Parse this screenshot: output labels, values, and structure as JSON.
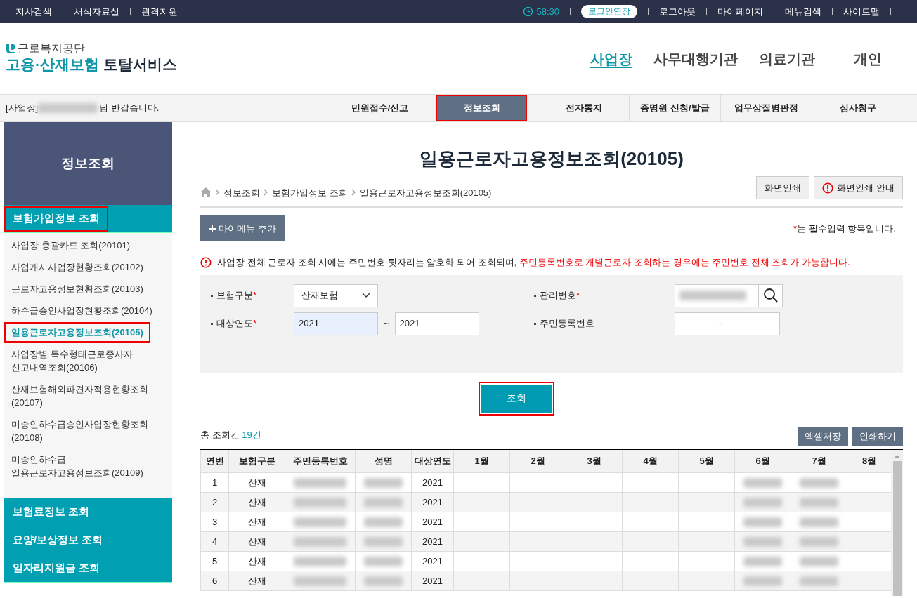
{
  "top_bar": {
    "left_links": [
      "지사검색",
      "서식자료실",
      "원격지원"
    ],
    "timer": "58:30",
    "extend_button": "로그인연장",
    "right_links": [
      "로그아웃",
      "마이페이지",
      "메뉴검색",
      "사이트맵"
    ]
  },
  "logo": {
    "org": "근로복지공단",
    "service_highlight": "고용·산재보험",
    "service": "토탈서비스"
  },
  "main_nav": [
    {
      "label": "사업장",
      "selected": true
    },
    {
      "label": "사무대행기관",
      "selected": false
    },
    {
      "label": "의료기관",
      "selected": false
    },
    {
      "label": "개인",
      "selected": false
    }
  ],
  "welcome": {
    "prefix": "[사업장]",
    "name_blurred": true,
    "suffix": "님 반갑습니다."
  },
  "tabs": [
    {
      "label": "민원접수/신고",
      "selected": false,
      "highlighted": false
    },
    {
      "label": "정보조회",
      "selected": true,
      "highlighted": true
    },
    {
      "label": "전자통지",
      "selected": false,
      "highlighted": false
    },
    {
      "label": "증명원 신청/발급",
      "selected": false,
      "highlighted": false
    },
    {
      "label": "업무상질병판정",
      "selected": false,
      "highlighted": false
    },
    {
      "label": "심사청구",
      "selected": false,
      "highlighted": false
    }
  ],
  "sidebar": {
    "title": "정보조회",
    "sections": [
      {
        "label": "보험가입정보 조회",
        "highlighted": true,
        "items": [
          {
            "label": "사업장 총괄카드 조회(20101)",
            "selected": false,
            "highlighted": false
          },
          {
            "label": "사업개시사업장현황조회(20102)",
            "selected": false,
            "highlighted": false
          },
          {
            "label": "근로자고용정보현황조회(20103)",
            "selected": false,
            "highlighted": false
          },
          {
            "label": "하수급승인사업장현황조회(20104)",
            "selected": false,
            "highlighted": false
          },
          {
            "label": "일용근로자고용정보조회(20105)",
            "selected": true,
            "highlighted": true
          },
          {
            "label": "사업장별 특수형태근로종사자\n신고내역조회(20106)",
            "selected": false,
            "highlighted": false
          },
          {
            "label": "산재보험해외파견자적용현황조회\n(20107)",
            "selected": false,
            "highlighted": false
          },
          {
            "label": "미승인하수급승인사업장현황조회\n(20108)",
            "selected": false,
            "highlighted": false
          },
          {
            "label": "미승인하수급\n일용근로자고용정보조회(20109)",
            "selected": false,
            "highlighted": false
          }
        ]
      },
      {
        "label": "보험료정보 조회",
        "highlighted": false
      },
      {
        "label": "요양/보상정보 조회",
        "highlighted": false
      },
      {
        "label": "일자리지원금 조회",
        "highlighted": false
      }
    ]
  },
  "page_title": "일용근로자고용정보조회(20105)",
  "breadcrumb": [
    "정보조회",
    "보험가입정보 조회",
    "일용근로자고용정보조회(20105)"
  ],
  "print_buttons": [
    {
      "label": "화면인쇄",
      "kind": "plain"
    },
    {
      "label": "화면인쇄 안내",
      "kind": "info"
    }
  ],
  "mymenu_button": "마이메뉴 추가",
  "required_legend": {
    "mark": "*",
    "text": "는 필수입력 항목입니다."
  },
  "notice": {
    "text": "사업장 전체 근로자 조회 시에는 주민번호 뒷자리는 암호화 되어 조회되며, ",
    "emphasis": "주민등록번호로 개별근로자 조회하는 경우에는 주민번호 전체 조회가 가능합니다."
  },
  "form": {
    "fields": [
      {
        "label": "보험구분",
        "required": true,
        "kind": "select",
        "value": "산재보험"
      },
      {
        "label": "관리번호",
        "required": true,
        "kind": "search",
        "value_blurred": true
      },
      {
        "label": "대상연도",
        "required": true,
        "kind": "range",
        "value": "2021",
        "separator": "~",
        "value_to": "2021"
      },
      {
        "label": "주민등록번호",
        "required": false,
        "kind": "rrn",
        "separator": "-"
      }
    ]
  },
  "query_button": {
    "label": "조회",
    "highlighted": true
  },
  "result": {
    "count_label": "총 조회건",
    "count": "19건",
    "buttons": [
      "엑셀저장",
      "인쇄하기"
    ]
  },
  "table": {
    "columns": [
      "연번",
      "보험구분",
      "주민등록번호",
      "성명",
      "대상연도",
      "1월",
      "2월",
      "3월",
      "4월",
      "5월",
      "6월",
      "7월",
      "8월"
    ],
    "rows": [
      {
        "cells": [
          {
            "text": "1"
          },
          {
            "text": "산재"
          },
          {
            "blurred": true
          },
          {
            "blurred": true
          },
          {
            "text": "2021"
          },
          {
            "blurred": false
          },
          {
            "blurred": false
          },
          {
            "blurred": false
          },
          {
            "blurred": false
          },
          {
            "blurred": false
          },
          {
            "blurred": true
          },
          {
            "blurred": true
          },
          {
            "blurred": false
          }
        ]
      },
      {
        "cells": [
          {
            "text": "2"
          },
          {
            "text": "산재"
          },
          {
            "blurred": true
          },
          {
            "blurred": true
          },
          {
            "text": "2021"
          },
          {
            "blurred": false
          },
          {
            "blurred": false
          },
          {
            "blurred": false
          },
          {
            "blurred": false
          },
          {
            "blurred": false
          },
          {
            "blurred": true
          },
          {
            "blurred": true
          },
          {
            "blurred": false
          }
        ]
      },
      {
        "cells": [
          {
            "text": "3"
          },
          {
            "text": "산재"
          },
          {
            "blurred": true
          },
          {
            "blurred": true
          },
          {
            "text": "2021"
          },
          {
            "blurred": false
          },
          {
            "blurred": false
          },
          {
            "blurred": false
          },
          {
            "blurred": false
          },
          {
            "blurred": false
          },
          {
            "blurred": true
          },
          {
            "blurred": true
          },
          {
            "blurred": false
          }
        ]
      },
      {
        "cells": [
          {
            "text": "4"
          },
          {
            "text": "산재"
          },
          {
            "blurred": true
          },
          {
            "blurred": true
          },
          {
            "text": "2021"
          },
          {
            "blurred": false
          },
          {
            "blurred": false
          },
          {
            "blurred": false
          },
          {
            "blurred": false
          },
          {
            "blurred": false
          },
          {
            "blurred": true
          },
          {
            "blurred": true
          },
          {
            "blurred": false
          }
        ]
      },
      {
        "cells": [
          {
            "text": "5"
          },
          {
            "text": "산재"
          },
          {
            "blurred": true
          },
          {
            "blurred": true
          },
          {
            "text": "2021"
          },
          {
            "blurred": false
          },
          {
            "blurred": false
          },
          {
            "blurred": false
          },
          {
            "blurred": false
          },
          {
            "blurred": false
          },
          {
            "blurred": true
          },
          {
            "blurred": true
          },
          {
            "blurred": false
          }
        ]
      },
      {
        "cells": [
          {
            "text": "6"
          },
          {
            "text": "산재"
          },
          {
            "blurred": true
          },
          {
            "blurred": true
          },
          {
            "text": "2021"
          },
          {
            "blurred": false
          },
          {
            "blurred": false
          },
          {
            "blurred": false
          },
          {
            "blurred": false
          },
          {
            "blurred": false
          },
          {
            "blurred": true
          },
          {
            "blurred": true
          },
          {
            "blurred": false
          }
        ]
      }
    ]
  }
}
